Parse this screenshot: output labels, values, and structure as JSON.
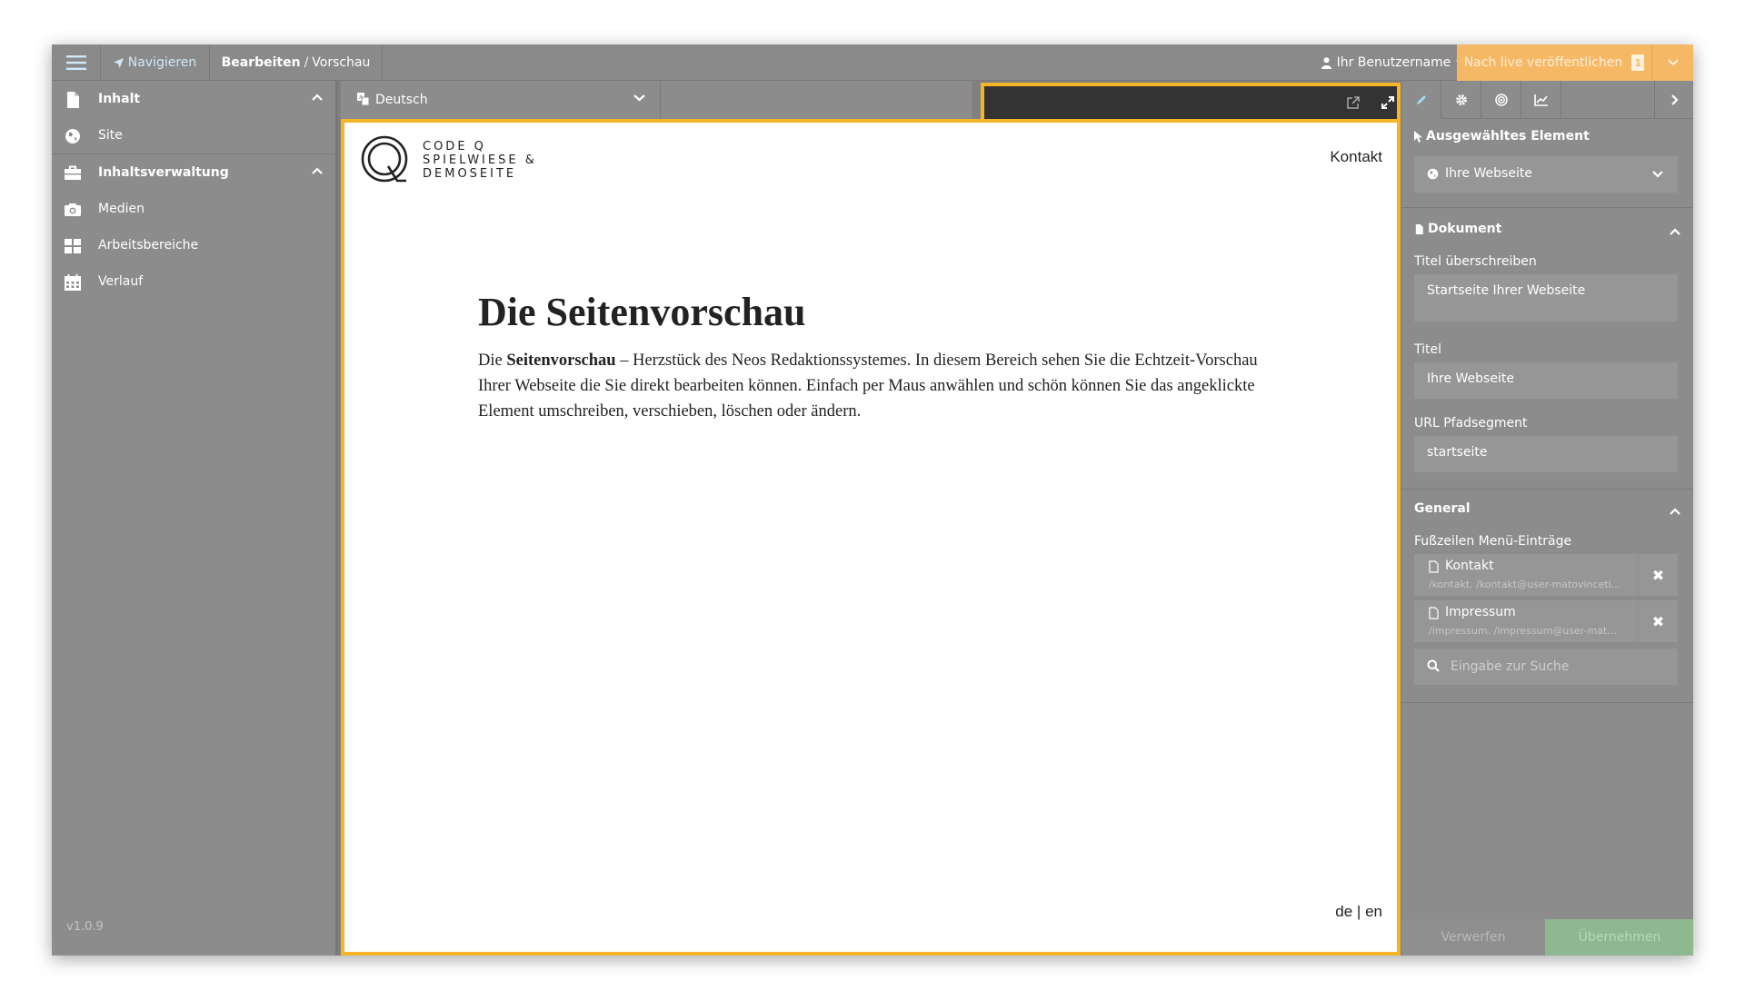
{
  "topbar": {
    "navigate_label": "Navigieren",
    "crumb_bold": "Bearbeiten",
    "crumb_sep": "/",
    "crumb_rest": "Vorschau",
    "username": "Ihr Benutzername",
    "publish_label": "Nach live veröffentlichen",
    "publish_count": "1"
  },
  "sidebar": {
    "items": [
      {
        "label": "Inhalt",
        "icon": "file-icon"
      },
      {
        "label": "Site",
        "icon": "globe-icon"
      },
      {
        "label": "Inhaltsverwaltung",
        "icon": "briefcase-icon"
      },
      {
        "label": "Medien",
        "icon": "camera-icon"
      },
      {
        "label": "Arbeitsbereiche",
        "icon": "grid-icon"
      },
      {
        "label": "Verlauf",
        "icon": "calendar-icon"
      }
    ],
    "version": "v1.0.9"
  },
  "center": {
    "language": "Deutsch"
  },
  "preview": {
    "logo_line1": "CODE Q",
    "logo_line2": "SPIELWIESE &",
    "logo_line3": "DEMOSEITE",
    "nav_link": "Kontakt",
    "headline": "Die Seitenvorschau",
    "para_start": "Die ",
    "para_bold": "Seitenvorschau",
    "para_rest": " – Herzstück des Neos Redaktionssystemes. In diesem Bereich sehen Sie die Echtzeit-Vorschau Ihrer Webseite die Sie direkt bearbeiten können. Einfach per Maus anwählen und schön können Sie das angeklickte Element umschreiben, verschieben, löschen oder ändern.",
    "lang_de": "de",
    "lang_sep": "|",
    "lang_en": "en"
  },
  "inspector": {
    "selected_title": "Ausgewähltes Element",
    "selected_value": "Ihre Webseite",
    "document_title": "Dokument",
    "field_title_override_label": "Titel überschreiben",
    "field_title_override_value": "Startseite Ihrer Webseite",
    "field_title_label": "Titel",
    "field_title_value": "Ihre Webseite",
    "field_url_label": "URL Pfadsegment",
    "field_url_value": "startseite",
    "general_title": "General",
    "footer_menu_label": "Fußzeilen Menü-Einträge",
    "refs": [
      {
        "name": "Kontakt",
        "path": "/kontakt. /kontakt@user-matovinceti..."
      },
      {
        "name": "Impressum",
        "path": "/impressum. /impressum@user-mat..."
      }
    ],
    "search_placeholder": "Eingabe zur Suche",
    "discard_label": "Verwerfen",
    "apply_label": "Übernehmen"
  },
  "colors": {
    "accent_orange": "#f6b428",
    "publish_orange": "#f5b865",
    "apply_green": "#8eb890",
    "link_blue": "#cfe8f8"
  }
}
